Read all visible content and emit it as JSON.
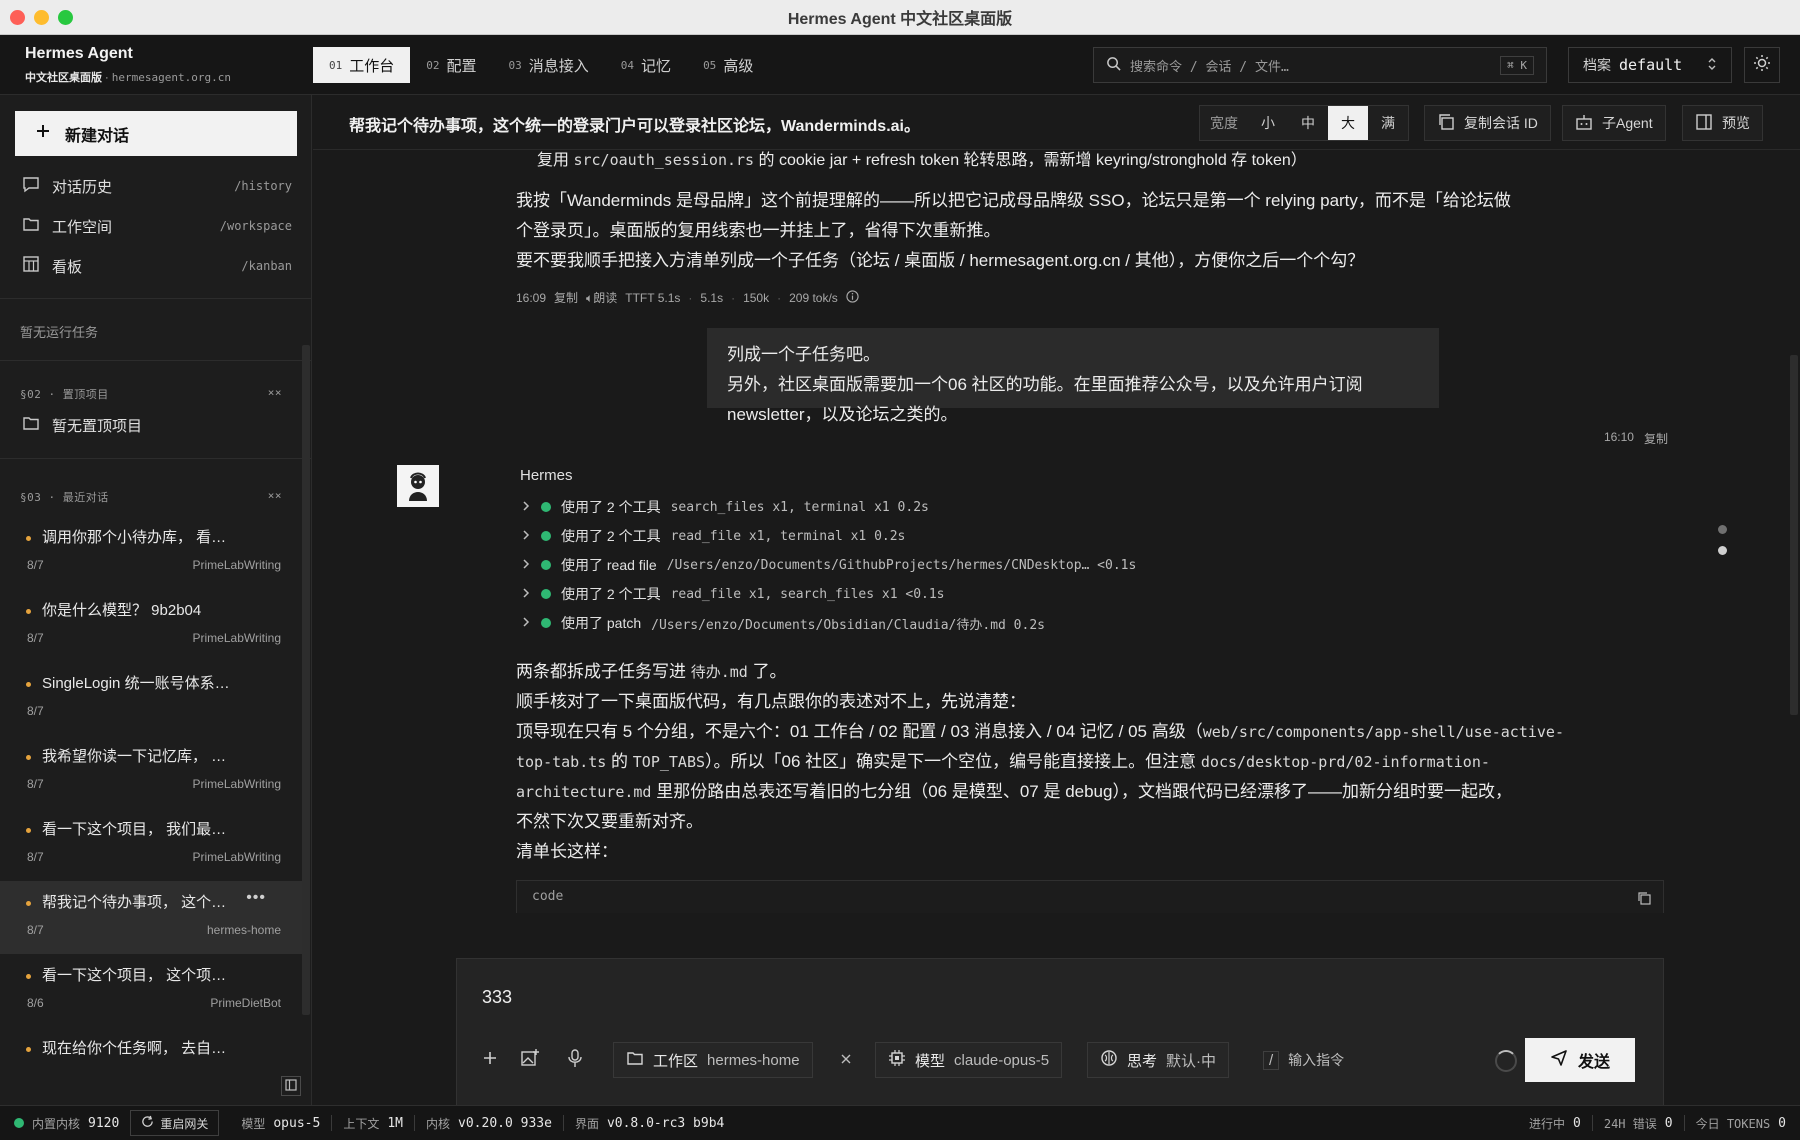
{
  "window": {
    "title": "Hermes Agent 中文社区桌面版"
  },
  "brand": {
    "name": "Hermes Agent",
    "subtitle": "中文社区桌面版",
    "domain": "hermesagent.org.cn"
  },
  "tabs": [
    {
      "num": "01",
      "label": "工作台",
      "active": true
    },
    {
      "num": "02",
      "label": "配置"
    },
    {
      "num": "03",
      "label": "消息接入"
    },
    {
      "num": "04",
      "label": "记忆"
    },
    {
      "num": "05",
      "label": "高级"
    }
  ],
  "search": {
    "placeholder": "搜索命令 / 会话 / 文件…",
    "shortcut": "⌘ K"
  },
  "profile": {
    "label": "档案",
    "value": "default"
  },
  "sidebar": {
    "new_chat": "新建对话",
    "nav": [
      {
        "label": "对话历史",
        "path": "/history"
      },
      {
        "label": "工作空间",
        "path": "/workspace"
      },
      {
        "label": "看板",
        "path": "/kanban"
      }
    ],
    "no_tasks": "暂无运行任务",
    "pinned_header": "§02 · 置顶项目",
    "pinned_empty": "暂无置顶项目",
    "recent_header": "§03 · 最近对话",
    "collapse_mark": "×",
    "conversations": [
      {
        "title": "调用你那个小待办库， 看…",
        "date": "8/7",
        "project": "PrimeLabWriting"
      },
      {
        "title": "你是什么模型？ 9b2b04",
        "date": "8/7",
        "project": "PrimeLabWriting"
      },
      {
        "title": "SingleLogin 统一账号体系…",
        "date": "8/7",
        "project": ""
      },
      {
        "title": "我希望你读一下记忆库， …",
        "date": "8/7",
        "project": "PrimeLabWriting"
      },
      {
        "title": "看一下这个项目， 我们最…",
        "date": "8/7",
        "project": "PrimeLabWriting"
      },
      {
        "title": "帮我记个待办事项， 这个…",
        "date": "8/7",
        "project": "hermes-home",
        "active": true
      },
      {
        "title": "看一下这个项目， 这个项…",
        "date": "8/6",
        "project": "PrimeDietBot"
      },
      {
        "title": "现在给你个任务啊， 去自…",
        "date": "",
        "project": ""
      }
    ]
  },
  "thread": {
    "title": "帮我记个待办事项，这个统一的登录门户可以登录社区论坛，Wanderminds.ai。",
    "width_label": "宽度",
    "width_options": [
      "小",
      "中",
      "大",
      "满"
    ],
    "width_selected": "大",
    "copy_id": "复制会话 ID",
    "sub_agent": "子Agent",
    "preview": "预览"
  },
  "messages": {
    "a1_top_prefix": "复用",
    "a1_top_code": "src/oauth_session.rs",
    "a1_top_suffix": "的 cookie jar + refresh token 轮转思路，需新增 keyring/stronghold 存 token）",
    "a1_line1": "我按「Wanderminds 是母品牌」这个前提理解的——所以把它记成母品牌级 SSO，论坛只是第一个 relying party，而不是「给论坛做",
    "a1_line2": "个登录页」。桌面版的复用线索也一并挂上了，省得下次重新推。",
    "a1_line3": "要不要我顺手把接入方清单列成一个子任务（论坛 / 桌面版 / hermesagent.org.cn / 其他），方便你之后一个个勾？",
    "a1_meta": {
      "time": "16:09",
      "copy": "复制",
      "read": "朗读",
      "ttft": "TTFT 5.1s",
      "dur": "5.1s",
      "tokens": "150k",
      "speed": "209 tok/s"
    },
    "user_line1": "列成一个子任务吧。",
    "user_line2": "另外，社区桌面版需要加一个06 社区的功能。在里面推荐公众号，以及允许用户订阅newsletter，以及论坛之类的。",
    "user_meta": {
      "time": "16:10",
      "copy": "复制"
    },
    "agent_name": "Hermes",
    "tools": [
      {
        "label": "使用了 2 个工具",
        "detail": "search_files x1, terminal x1 0.2s"
      },
      {
        "label": "使用了 2 个工具",
        "detail": "read_file x1, terminal x1 0.2s"
      },
      {
        "label": "使用了 read file",
        "detail": "/Users/enzo/Documents/GithubProjects/hermes/CNDesktop… <0.1s"
      },
      {
        "label": "使用了 2 个工具",
        "detail": "read_file x1, search_files x1 <0.1s"
      },
      {
        "label": "使用了 patch",
        "detail": "/Users/enzo/Documents/Obsidian/Claudia/待办.md 0.2s"
      }
    ],
    "a2_l1_prefix": "两条都拆成子任务写进",
    "a2_l1_code": "待办.md",
    "a2_l1_suffix": "了。",
    "a2_l2": "顺手核对了一下桌面版代码，有几点跟你的表述对不上，先说清楚：",
    "a2_l3_prefix": "顶导现在只有 5 个分组，不是六个：01 工作台 / 02 配置 / 03 消息接入 / 04 记忆 / 05 高级（",
    "a2_l3_code": "web/src/components/app-shell/use-active-",
    "a2_l4_code1": "top-tab.ts",
    "a2_l4_mid": "的",
    "a2_l4_code2": "TOP_TABS",
    "a2_l4_text": "）。所以「06 社区」确实是下一个空位，编号能直接接上。但注意",
    "a2_l4_code3": "docs/desktop-prd/02-information-",
    "a2_l5_code": "architecture.md",
    "a2_l5_text": "里那份路由总表还写着旧的七分组（06 是模型、07 是 debug），文档跟代码已经漂移了——加新分组时要一起改，",
    "a2_l6": "不然下次又要重新对齐。",
    "a2_l7": "清单长这样：",
    "code_label": "code"
  },
  "composer": {
    "input_value": "333",
    "workspace_label": "工作区",
    "workspace_value": "hermes-home",
    "model_label": "模型",
    "model_value": "claude-opus-5",
    "think_label": "思考",
    "think_value": "默认·中",
    "command_placeholder": "输入指令",
    "send": "发送"
  },
  "status": {
    "kernel_label": "内置内核",
    "kernel_port": "9120",
    "restart": "重启网关",
    "model_label": "模型",
    "model_value": "opus-5",
    "context_label": "上下文",
    "context_value": "1M",
    "core_label": "内核",
    "core_value": "v0.20.0 933e",
    "ui_label": "界面",
    "ui_value": "v0.8.0-rc3 b9b4",
    "running_label": "进行中",
    "running_value": "0",
    "errors_label": "24H 错误",
    "errors_value": "0",
    "tokens_label": "今日 TOKENS",
    "tokens_value": "0"
  },
  "colors": {
    "accent_dot": "#e5a33d",
    "tool_ok": "#2fb873",
    "kernel_ok": "#2fb873"
  }
}
